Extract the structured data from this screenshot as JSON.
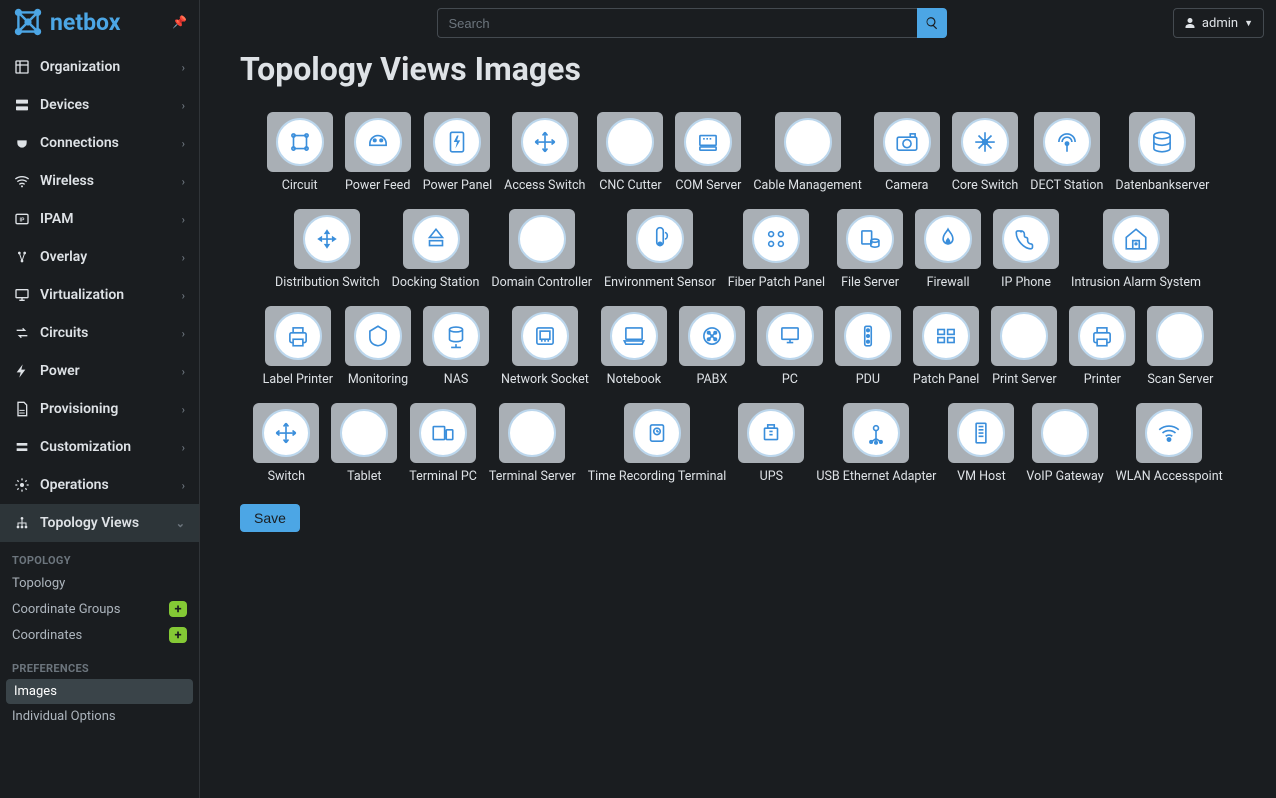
{
  "app": {
    "name": "netbox"
  },
  "header": {
    "search_placeholder": "Search",
    "user": "admin"
  },
  "sidebar": {
    "items": [
      {
        "label": "Organization",
        "icon": "org"
      },
      {
        "label": "Devices",
        "icon": "server"
      },
      {
        "label": "Connections",
        "icon": "plug"
      },
      {
        "label": "Wireless",
        "icon": "wifi"
      },
      {
        "label": "IPAM",
        "icon": "ip"
      },
      {
        "label": "Overlay",
        "icon": "overlay"
      },
      {
        "label": "Virtualization",
        "icon": "monitor"
      },
      {
        "label": "Circuits",
        "icon": "swap"
      },
      {
        "label": "Power",
        "icon": "bolt"
      },
      {
        "label": "Provisioning",
        "icon": "doc"
      },
      {
        "label": "Customization",
        "icon": "custom"
      },
      {
        "label": "Operations",
        "icon": "gear"
      },
      {
        "label": "Topology Views",
        "icon": "tree",
        "active": true
      }
    ],
    "topology": {
      "header": "TOPOLOGY",
      "items": [
        {
          "label": "Topology"
        },
        {
          "label": "Coordinate Groups",
          "add": true
        },
        {
          "label": "Coordinates",
          "add": true
        }
      ]
    },
    "preferences": {
      "header": "PREFERENCES",
      "items": [
        {
          "label": "Images",
          "active": true
        },
        {
          "label": "Individual Options"
        }
      ]
    }
  },
  "page": {
    "title": "Topology Views Images",
    "save_label": "Save"
  },
  "tiles": [
    [
      "Circuit",
      "Power Feed",
      "Power Panel",
      "Access Switch",
      "CNC Cutter",
      "COM Server",
      "Cable Management",
      "Camera",
      "Core Switch",
      "DECT Station",
      "Datenbankserver"
    ],
    [
      "Distribution Switch",
      "Docking Station",
      "Domain Controller",
      "Environment Sensor",
      "Fiber Patch Panel",
      "File Server",
      "Firewall",
      "IP Phone",
      "Intrusion Alarm System"
    ],
    [
      "Label Printer",
      "Monitoring",
      "NAS",
      "Network Socket",
      "Notebook",
      "PABX",
      "PC",
      "PDU",
      "Patch Panel",
      "Print Server",
      "Printer",
      "Scan Server"
    ],
    [
      "Switch",
      "Tablet",
      "Terminal PC",
      "Terminal Server",
      "Time Recording Terminal",
      "UPS",
      "USB Ethernet Adapter",
      "VM Host",
      "VoIP Gateway",
      "WLAN Accesspoint"
    ]
  ]
}
